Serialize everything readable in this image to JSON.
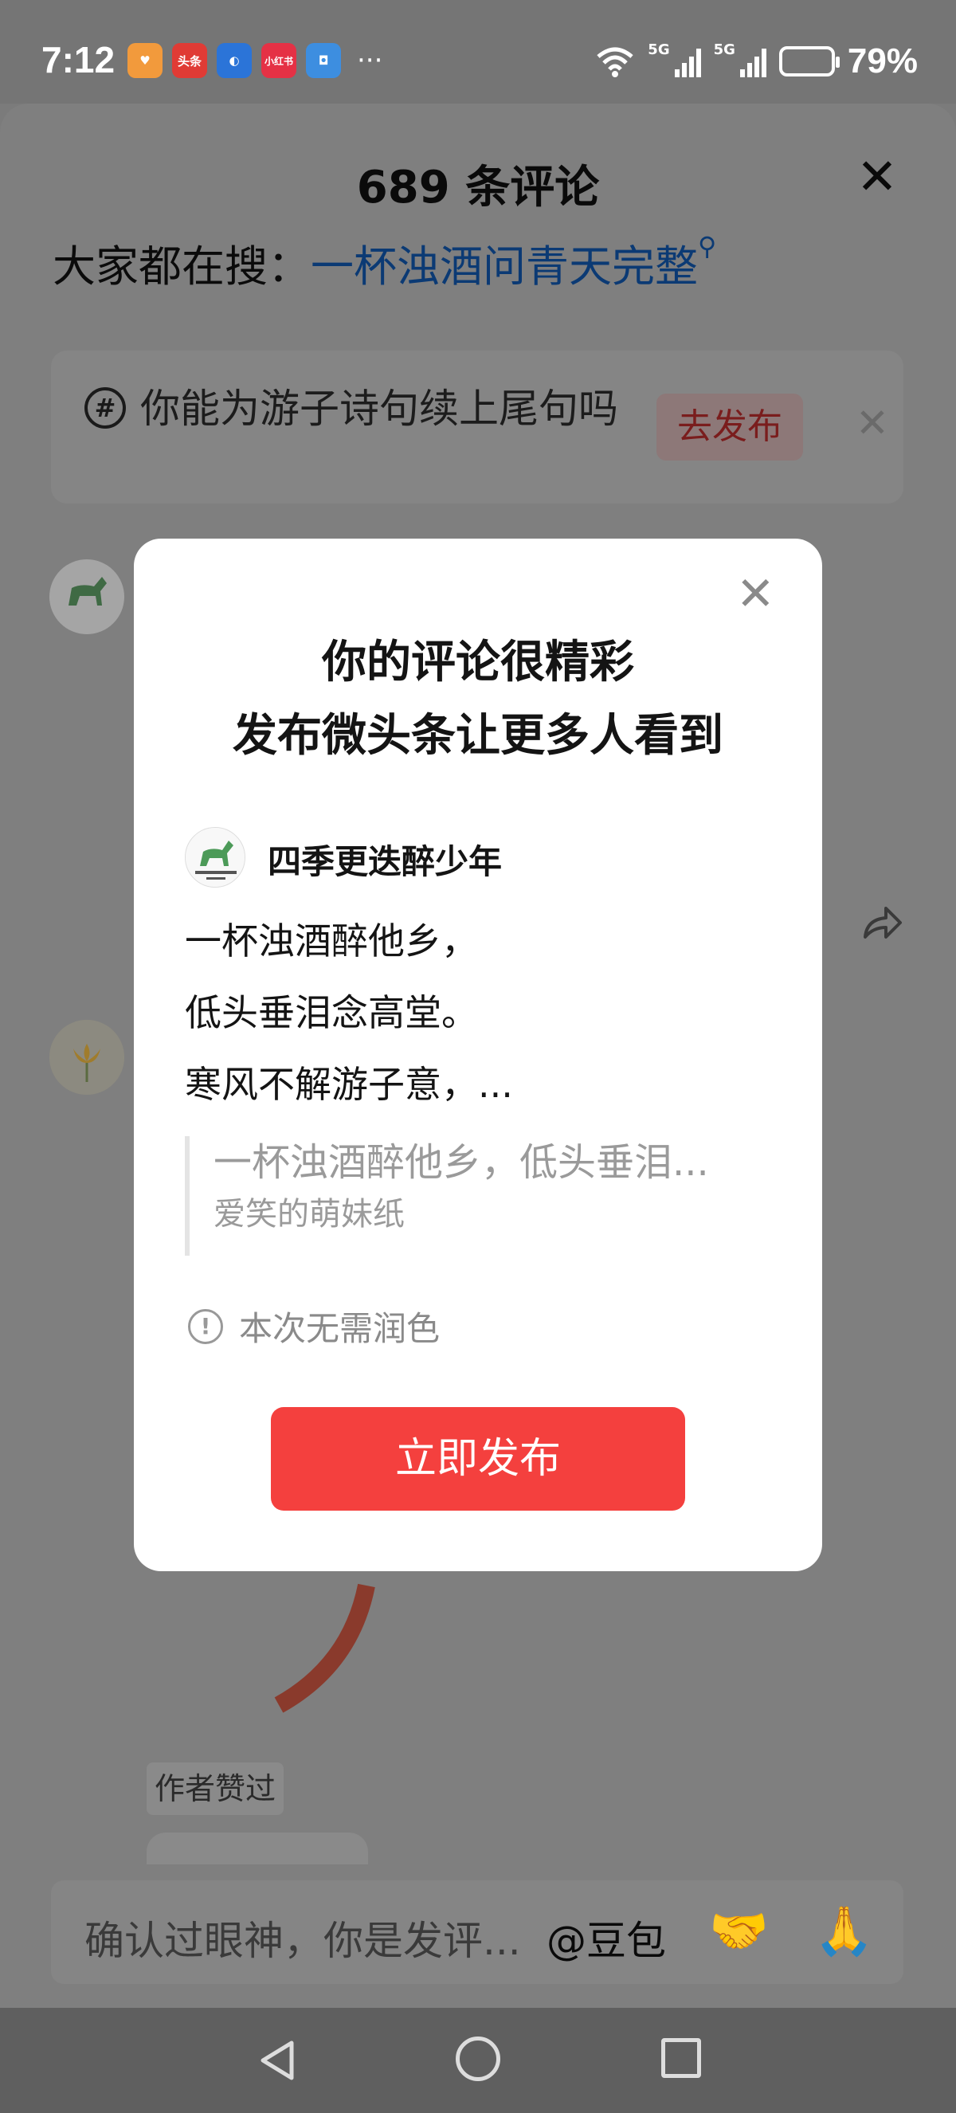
{
  "status_bar": {
    "time": "7:12",
    "apps": [
      {
        "icon": "heart-app-icon",
        "label": "",
        "color": "#f29a3c"
      },
      {
        "icon": "toutiao-app-icon",
        "label": "头条",
        "color": "#e03b35"
      },
      {
        "icon": "browser-app-icon",
        "label": "",
        "color": "#2b74d8"
      },
      {
        "icon": "xiaohongshu-app-icon",
        "label": "小红书",
        "color": "#e53145"
      },
      {
        "icon": "security-app-icon",
        "label": "",
        "color": "#3d8ee0"
      }
    ],
    "more": "···",
    "network1": "5G",
    "network2": "5G",
    "battery_percent": "79%"
  },
  "sheet": {
    "title": "689 条评论",
    "search_label": "大家都在搜：",
    "search_keyword": "一杯浊酒问青天完整",
    "topic": {
      "icon": "#",
      "text": "你能为游子诗句续上尾句吗",
      "button": "去发布"
    },
    "author_liked": "作者赞过",
    "input": {
      "placeholder": "确认过眼神，你是发评...",
      "mention": "@豆包",
      "emoji1": "🤝",
      "emoji2": "🙏"
    }
  },
  "modal": {
    "title_line1": "你的评论很精彩",
    "title_line2": "发布微头条让更多人看到",
    "username": "四季更迭醉少年",
    "poem_line1": "一杯浊酒醉他乡，",
    "poem_line2": "低头垂泪念高堂。",
    "poem_line3": "寒风不解游子意，...",
    "quote_text": "一杯浊酒醉他乡，低头垂泪...",
    "quote_author": "爱笑的萌妹纸",
    "notice": "本次无需润色",
    "publish_button": "立即发布"
  },
  "colors": {
    "accent": "#f4403e",
    "search_keyword": "#0b3a74"
  }
}
